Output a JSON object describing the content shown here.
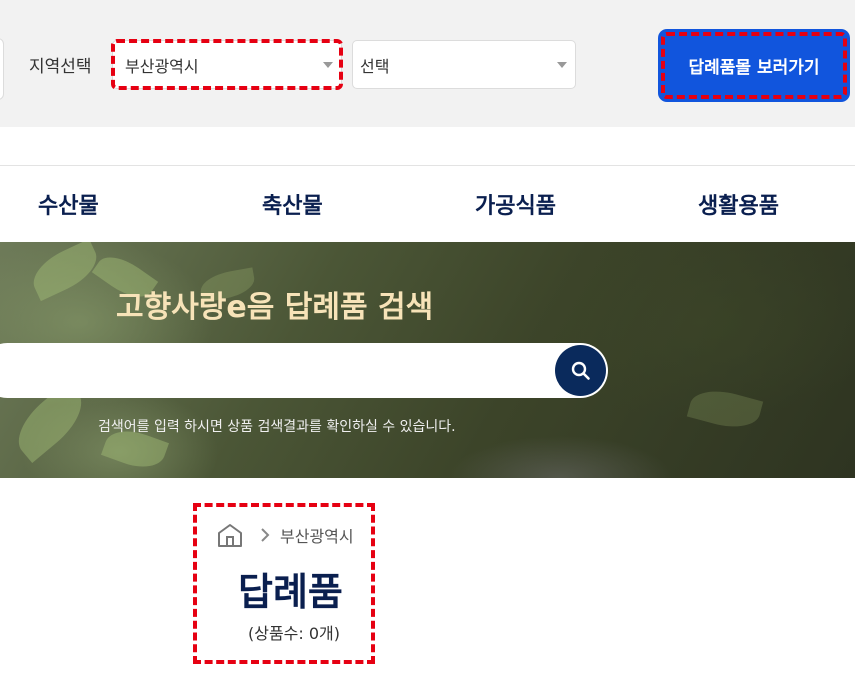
{
  "region_select": {
    "label": "지역선택",
    "city_value": "부산광역시",
    "district_value": "선택"
  },
  "goto_button": {
    "label": "답례품몰 보러가기"
  },
  "categories": [
    "수산물",
    "축산물",
    "가공식품",
    "생활용품"
  ],
  "hero": {
    "title": "고향사랑e음 답례품 검색",
    "search_value": "",
    "hint": "검색어를 입력 하시면 상품 검색결과를 확인하실 수 있습니다."
  },
  "breadcrumb": {
    "region": "부산광역시"
  },
  "result": {
    "title": "답례품",
    "count_text": "(상품수: 0개)"
  },
  "icons": {
    "home": "home-icon",
    "chevron": "chevron-right-icon",
    "search": "search-icon",
    "caret": "caret-down-icon"
  },
  "colors": {
    "navy": "#0a1f4f",
    "button_blue": "#1155dd",
    "annotation_red": "#e60012",
    "hero_title": "#f7e3b8"
  }
}
